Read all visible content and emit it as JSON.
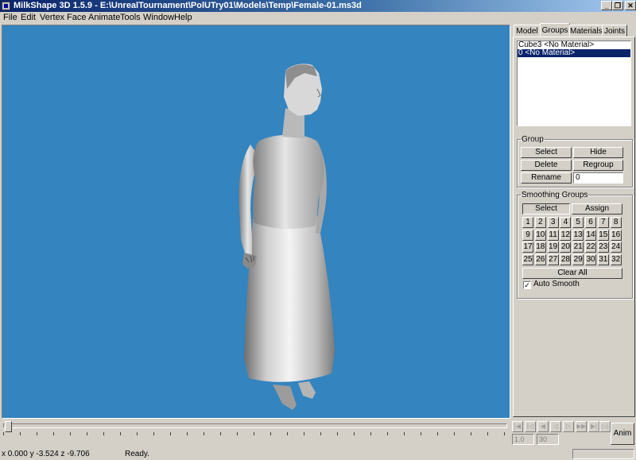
{
  "window": {
    "title": "MilkShape 3D 1.5.9 - E:\\UnrealTournament\\PolUTry01\\Models\\Temp\\Female-01.ms3d",
    "min_glyph": "_",
    "restore_glyph": "❐",
    "close_glyph": "✕"
  },
  "menu": [
    "File",
    "Edit",
    "Vertex",
    "Face",
    "Animate",
    "Tools",
    "Window",
    "Help"
  ],
  "tabs": [
    "Model",
    "Groups",
    "Materials",
    "Joints"
  ],
  "active_tab": "Groups",
  "groups_list": [
    {
      "label": "Cube3 <No Material>",
      "selected": false
    },
    {
      "label": "0 <No Material>",
      "selected": true
    }
  ],
  "group_box": {
    "title": "Group",
    "select": "Select",
    "hide": "Hide",
    "delete": "Delete",
    "regroup": "Regroup",
    "rename": "Rename",
    "rename_value": "0"
  },
  "smoothing": {
    "title": "Smoothing Groups",
    "select": "Select",
    "assign": "Assign",
    "numbers": [
      "1",
      "2",
      "3",
      "4",
      "5",
      "6",
      "7",
      "8",
      "9",
      "10",
      "11",
      "12",
      "13",
      "14",
      "15",
      "16",
      "17",
      "18",
      "19",
      "20",
      "21",
      "22",
      "23",
      "24",
      "25",
      "26",
      "27",
      "28",
      "29",
      "30",
      "31",
      "32"
    ],
    "clear_all": "Clear All",
    "auto_smooth": "Auto Smooth",
    "auto_smooth_checked": true,
    "check_glyph": "✓"
  },
  "timeline": {
    "glyphs": [
      "|◀",
      "|◁",
      "◀",
      "◁",
      "▷",
      "▶▶",
      "▶|",
      "▷|"
    ],
    "frame_current": "1.0",
    "frame_total": "30",
    "anim_button": "Anim"
  },
  "status": {
    "coords": "x 0.000 y -3.524 z -9.706",
    "message": "Ready."
  },
  "colors": {
    "viewport_bg": "#3384bf",
    "title_gradient_start": "#0a246a",
    "selection": "#0a246a",
    "face": "#d4d0c8"
  }
}
